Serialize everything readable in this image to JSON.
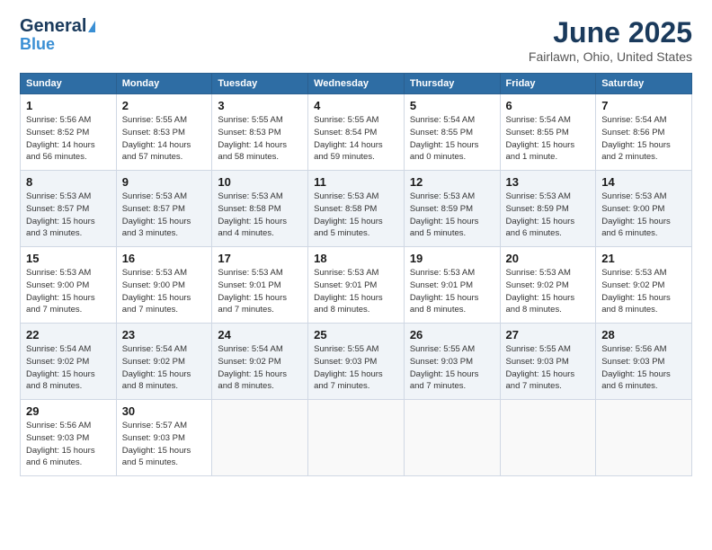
{
  "logo": {
    "line1": "General",
    "line2": "Blue"
  },
  "title": "June 2025",
  "subtitle": "Fairlawn, Ohio, United States",
  "days_of_week": [
    "Sunday",
    "Monday",
    "Tuesday",
    "Wednesday",
    "Thursday",
    "Friday",
    "Saturday"
  ],
  "weeks": [
    [
      {
        "day": "1",
        "info": "Sunrise: 5:56 AM\nSunset: 8:52 PM\nDaylight: 14 hours\nand 56 minutes."
      },
      {
        "day": "2",
        "info": "Sunrise: 5:55 AM\nSunset: 8:53 PM\nDaylight: 14 hours\nand 57 minutes."
      },
      {
        "day": "3",
        "info": "Sunrise: 5:55 AM\nSunset: 8:53 PM\nDaylight: 14 hours\nand 58 minutes."
      },
      {
        "day": "4",
        "info": "Sunrise: 5:55 AM\nSunset: 8:54 PM\nDaylight: 14 hours\nand 59 minutes."
      },
      {
        "day": "5",
        "info": "Sunrise: 5:54 AM\nSunset: 8:55 PM\nDaylight: 15 hours\nand 0 minutes."
      },
      {
        "day": "6",
        "info": "Sunrise: 5:54 AM\nSunset: 8:55 PM\nDaylight: 15 hours\nand 1 minute."
      },
      {
        "day": "7",
        "info": "Sunrise: 5:54 AM\nSunset: 8:56 PM\nDaylight: 15 hours\nand 2 minutes."
      }
    ],
    [
      {
        "day": "8",
        "info": "Sunrise: 5:53 AM\nSunset: 8:57 PM\nDaylight: 15 hours\nand 3 minutes."
      },
      {
        "day": "9",
        "info": "Sunrise: 5:53 AM\nSunset: 8:57 PM\nDaylight: 15 hours\nand 3 minutes."
      },
      {
        "day": "10",
        "info": "Sunrise: 5:53 AM\nSunset: 8:58 PM\nDaylight: 15 hours\nand 4 minutes."
      },
      {
        "day": "11",
        "info": "Sunrise: 5:53 AM\nSunset: 8:58 PM\nDaylight: 15 hours\nand 5 minutes."
      },
      {
        "day": "12",
        "info": "Sunrise: 5:53 AM\nSunset: 8:59 PM\nDaylight: 15 hours\nand 5 minutes."
      },
      {
        "day": "13",
        "info": "Sunrise: 5:53 AM\nSunset: 8:59 PM\nDaylight: 15 hours\nand 6 minutes."
      },
      {
        "day": "14",
        "info": "Sunrise: 5:53 AM\nSunset: 9:00 PM\nDaylight: 15 hours\nand 6 minutes."
      }
    ],
    [
      {
        "day": "15",
        "info": "Sunrise: 5:53 AM\nSunset: 9:00 PM\nDaylight: 15 hours\nand 7 minutes."
      },
      {
        "day": "16",
        "info": "Sunrise: 5:53 AM\nSunset: 9:00 PM\nDaylight: 15 hours\nand 7 minutes."
      },
      {
        "day": "17",
        "info": "Sunrise: 5:53 AM\nSunset: 9:01 PM\nDaylight: 15 hours\nand 7 minutes."
      },
      {
        "day": "18",
        "info": "Sunrise: 5:53 AM\nSunset: 9:01 PM\nDaylight: 15 hours\nand 8 minutes."
      },
      {
        "day": "19",
        "info": "Sunrise: 5:53 AM\nSunset: 9:01 PM\nDaylight: 15 hours\nand 8 minutes."
      },
      {
        "day": "20",
        "info": "Sunrise: 5:53 AM\nSunset: 9:02 PM\nDaylight: 15 hours\nand 8 minutes."
      },
      {
        "day": "21",
        "info": "Sunrise: 5:53 AM\nSunset: 9:02 PM\nDaylight: 15 hours\nand 8 minutes."
      }
    ],
    [
      {
        "day": "22",
        "info": "Sunrise: 5:54 AM\nSunset: 9:02 PM\nDaylight: 15 hours\nand 8 minutes."
      },
      {
        "day": "23",
        "info": "Sunrise: 5:54 AM\nSunset: 9:02 PM\nDaylight: 15 hours\nand 8 minutes."
      },
      {
        "day": "24",
        "info": "Sunrise: 5:54 AM\nSunset: 9:02 PM\nDaylight: 15 hours\nand 8 minutes."
      },
      {
        "day": "25",
        "info": "Sunrise: 5:55 AM\nSunset: 9:03 PM\nDaylight: 15 hours\nand 7 minutes."
      },
      {
        "day": "26",
        "info": "Sunrise: 5:55 AM\nSunset: 9:03 PM\nDaylight: 15 hours\nand 7 minutes."
      },
      {
        "day": "27",
        "info": "Sunrise: 5:55 AM\nSunset: 9:03 PM\nDaylight: 15 hours\nand 7 minutes."
      },
      {
        "day": "28",
        "info": "Sunrise: 5:56 AM\nSunset: 9:03 PM\nDaylight: 15 hours\nand 6 minutes."
      }
    ],
    [
      {
        "day": "29",
        "info": "Sunrise: 5:56 AM\nSunset: 9:03 PM\nDaylight: 15 hours\nand 6 minutes."
      },
      {
        "day": "30",
        "info": "Sunrise: 5:57 AM\nSunset: 9:03 PM\nDaylight: 15 hours\nand 5 minutes."
      },
      {
        "day": "",
        "info": ""
      },
      {
        "day": "",
        "info": ""
      },
      {
        "day": "",
        "info": ""
      },
      {
        "day": "",
        "info": ""
      },
      {
        "day": "",
        "info": ""
      }
    ]
  ]
}
